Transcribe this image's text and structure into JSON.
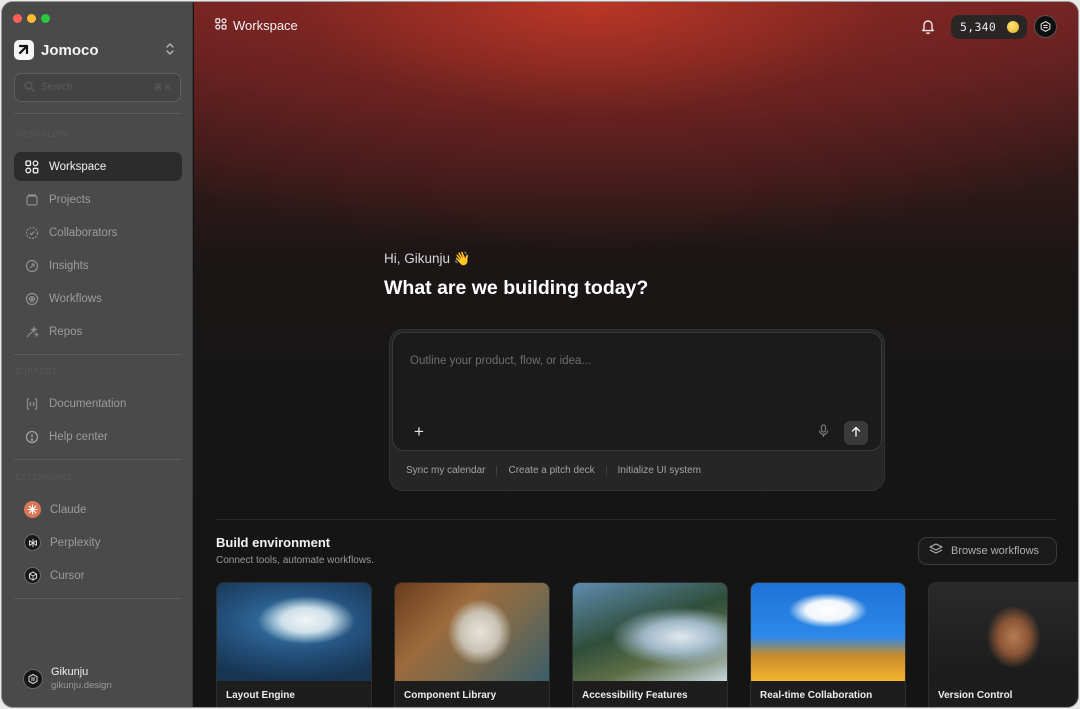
{
  "app": {
    "brand_name": "Jomoco",
    "accent": "#c0392b",
    "window_controls": [
      "close",
      "minimize",
      "zoom"
    ]
  },
  "sidebar": {
    "search": {
      "placeholder": "Search",
      "shortcut": "⌘ K"
    },
    "sections": {
      "workflow": "WORKFLOW",
      "support": "SUPPORT",
      "extensions": "EXTENSIONS"
    },
    "nav": [
      {
        "label": "Workspace",
        "icon": "workspace-grid-icon",
        "active": true
      },
      {
        "label": "Projects",
        "icon": "folder-icon"
      },
      {
        "label": "Collaborators",
        "icon": "collaborators-icon"
      },
      {
        "label": "Insights",
        "icon": "insights-icon"
      },
      {
        "label": "Workflows",
        "icon": "workflows-icon"
      },
      {
        "label": "Repos",
        "icon": "repos-icon"
      }
    ],
    "support": [
      {
        "label": "Documentation",
        "icon": "documentation-icon"
      },
      {
        "label": "Help center",
        "icon": "help-icon"
      }
    ],
    "extensions": [
      {
        "label": "Claude",
        "icon": "claude-icon",
        "color": "#d97757"
      },
      {
        "label": "Perplexity",
        "icon": "perplexity-icon",
        "color": "#1a1a1a"
      },
      {
        "label": "Cursor",
        "icon": "cursor-icon",
        "color": "#1a1a1a"
      }
    ],
    "user": {
      "name": "Gikunju",
      "handle": "gikunju.design"
    }
  },
  "topbar": {
    "title": "Workspace",
    "credits": "5,340"
  },
  "hero": {
    "greeting": "Hi, Gikunju 👋",
    "headline": "What are we building today?"
  },
  "composer": {
    "placeholder": "Outline your product, flow, or idea...",
    "suggestions": [
      "Sync my calendar",
      "Create a pitch deck",
      "Initialize UI system"
    ]
  },
  "build": {
    "title": "Build environment",
    "subtitle": "Connect tools, automate workflows.",
    "browse_label": "Browse workflows",
    "cards": [
      {
        "title": "Layout Engine"
      },
      {
        "title": "Component Library"
      },
      {
        "title": "Accessibility Features"
      },
      {
        "title": "Real-time Collaboration"
      },
      {
        "title": "Version Control"
      }
    ]
  }
}
